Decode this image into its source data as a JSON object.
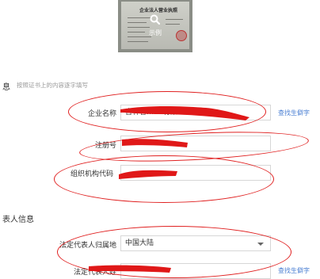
{
  "license": {
    "title": "企业法人营业执照",
    "caption": "示例",
    "icon": "magnifier-icon"
  },
  "company_section": {
    "title": "息",
    "hint": "按照证书上的内容逐字填写",
    "fields": [
      {
        "label": "企业名称",
        "value": "吉林省…… 有限公司",
        "link": "查找生僻字"
      },
      {
        "label": "注册号",
        "value": ""
      },
      {
        "label": "组织机构代码",
        "value": ""
      }
    ]
  },
  "rep_section": {
    "title": "表人信息",
    "fields": [
      {
        "label": "法定代表人归属地",
        "value": "中国大陆"
      },
      {
        "label": "法定代表人姓",
        "value": "",
        "link": "查找生僻字"
      }
    ]
  },
  "colors": {
    "annotation": "#e02020",
    "link": "#4a7fd3"
  }
}
